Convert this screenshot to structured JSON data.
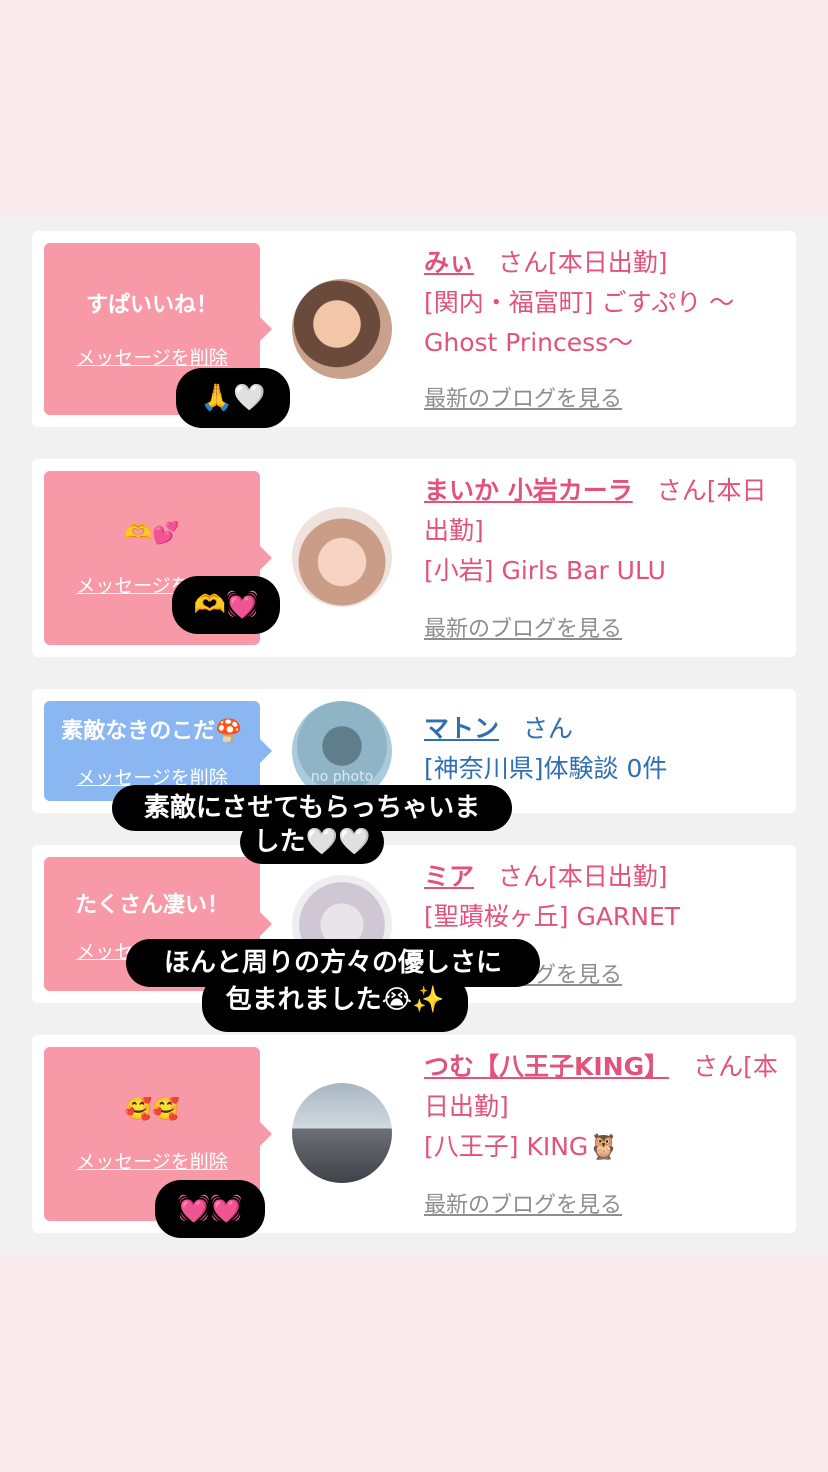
{
  "cards": [
    {
      "bubble_message": "すぱいいね！",
      "delete_label": "メッセージを削除",
      "name": "みぃ",
      "suffix": "さん[本日出勤]",
      "location": "[関内・福富町] ごすぷり 〜Ghost Princess〜",
      "blog_link": "最新のブログを見る"
    },
    {
      "bubble_message": "🫶💕",
      "delete_label": "メッセージを削除",
      "name": "まいか 小岩カーラ",
      "suffix": "さん[本日出勤]",
      "location": "[小岩] Girls Bar ULU",
      "blog_link": "最新のブログを見る"
    },
    {
      "bubble_message": "素敵なきのこだ🍄",
      "delete_label": "メッセージを削除",
      "avatar_text": "no photo",
      "name": "マトン",
      "suffix": "さん",
      "location": "[神奈川県]体験談 0件"
    },
    {
      "bubble_message": "たくさん凄い！",
      "delete_label": "メッセージを削除",
      "name": "ミア",
      "suffix": "さん[本日出勤]",
      "location": "[聖蹟桜ヶ丘] GARNET",
      "blog_link": "最新のブログを見る"
    },
    {
      "bubble_message": "🥰🥰",
      "delete_label": "メッセージを削除",
      "name": "つむ【八王子KING】",
      "suffix": "さん[本日出勤]",
      "location": "[八王子] KING🦉",
      "blog_link": "最新のブログを見る"
    }
  ],
  "stickers": {
    "s1": "🙏🤍",
    "s2": "🫶💓",
    "s3_line1": "素敵にさせてもらっちゃいま",
    "s3_line2": "した🤍🤍",
    "s4_line1": "ほんと周りの方々の優しさに",
    "s4_line2": "包まれました😭✨",
    "s5": "💓💓"
  },
  "colors": {
    "page_background": "#f8e9ea",
    "content_background": "#f1f1f1",
    "bubble_pink": "#f899a7",
    "bubble_blue": "#8ab6f2",
    "name_pink": "#e2527a",
    "name_blue": "#2f6fb2",
    "blog_link_gray": "#8e8e8e"
  }
}
